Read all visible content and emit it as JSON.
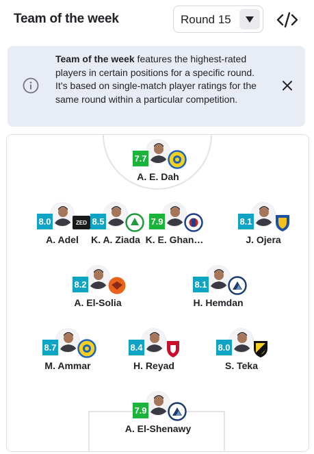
{
  "header": {
    "title": "Team of the week",
    "round_label": "Round 15"
  },
  "info": {
    "bold": "Team of the week",
    "text": " features the highest-rated players in certain positions for a specific round. It’s based on single-match player ratings for the same round within a particular competition."
  },
  "colors": {
    "rating_green": "#1bb43a",
    "rating_cyan": "#0fa3c4"
  },
  "players": [
    {
      "name": "A. E. Dah",
      "rating": "7.7",
      "rating_color": "#1bb43a",
      "club_icon": "yellow-blue-crest-icon"
    },
    {
      "name": "A. Adel",
      "rating": "8.0",
      "rating_color": "#0fa3c4",
      "club_icon": "zed-fc-icon"
    },
    {
      "name": "K. A. Ziada",
      "rating": "8.5",
      "rating_color": "#0fa3c4",
      "club_icon": "green-white-crest-icon"
    },
    {
      "name": "K. E. Ghan…",
      "rating": "7.9",
      "rating_color": "#1bb43a",
      "club_icon": "red-blue-crest-icon"
    },
    {
      "name": "J. Ojera",
      "rating": "8.1",
      "rating_color": "#0fa3c4",
      "club_icon": "blue-gold-shield-icon"
    },
    {
      "name": "A. El-Solia",
      "rating": "8.2",
      "rating_color": "#0fa3c4",
      "club_icon": "orange-eagle-crest-icon"
    },
    {
      "name": "H. Hemdan",
      "rating": "8.1",
      "rating_color": "#0fa3c4",
      "club_icon": "pyramids-crest-icon"
    },
    {
      "name": "M. Ammar",
      "rating": "8.7",
      "rating_color": "#0fa3c4",
      "club_icon": "yellow-blue-crest-icon"
    },
    {
      "name": "H. Reyad",
      "rating": "8.4",
      "rating_color": "#0fa3c4",
      "club_icon": "al-ahly-crest-icon"
    },
    {
      "name": "S. Teka",
      "rating": "8.0",
      "rating_color": "#0fa3c4",
      "club_icon": "yellow-black-shield-icon"
    },
    {
      "name": "A. El-Shenawy",
      "rating": "7.9",
      "rating_color": "#1bb43a",
      "club_icon": "pyramids-crest-icon"
    }
  ]
}
